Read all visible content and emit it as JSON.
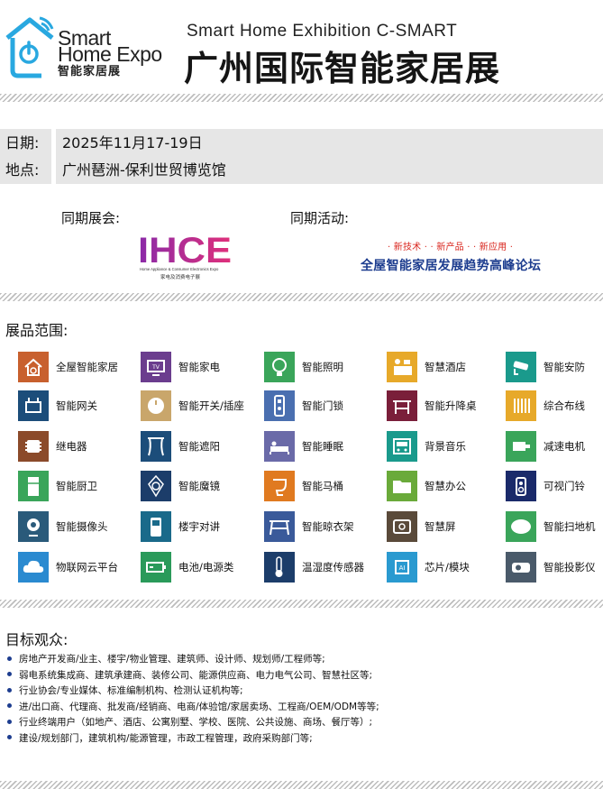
{
  "header": {
    "logo_line1": "Smart",
    "logo_line2": "Home Expo",
    "logo_line3": "智能家居展",
    "title_en": "Smart Home Exhibition C-SMART",
    "title_cn": "广州国际智能家居展"
  },
  "info": {
    "date_label": "日期:",
    "date_value": "2025年11月17-19日",
    "venue_label": "地点:",
    "venue_value": "广州琶洲-保利世贸博览馆"
  },
  "concurrent": {
    "exhibition_label": "同期展会:",
    "ihce_logo_text": "IHCE",
    "ihce_sub_en": "Home Appliance & Consumer Electronics Expo",
    "ihce_sub_cn": "家电及消费电子展",
    "activity_label": "同期活动:",
    "activity_tags": "· 新技术 ·  · 新产品 ·  · 新应用 ·",
    "activity_title": "全屋智能家居发展趋势高峰论坛"
  },
  "products": {
    "title": "展品范围:",
    "items": [
      {
        "label": "全屋智能家居",
        "icon": "smart-home-icon",
        "color": "#c8602e"
      },
      {
        "label": "智能家电",
        "icon": "tv-icon",
        "color": "#6b3d8e"
      },
      {
        "label": "智能照明",
        "icon": "bulb-icon",
        "color": "#3aa55a"
      },
      {
        "label": "智慧酒店",
        "icon": "hotel-reception-icon",
        "color": "#e7a92a"
      },
      {
        "label": "智能安防",
        "icon": "security-camera-icon",
        "color": "#1a9a8c"
      },
      {
        "label": "智能网关",
        "icon": "gateway-icon",
        "color": "#1c4d7a"
      },
      {
        "label": "智能开关/插座",
        "icon": "switch-icon",
        "color": "#c9a66b"
      },
      {
        "label": "智能门锁",
        "icon": "door-lock-icon",
        "color": "#4a6fb0"
      },
      {
        "label": "智能升降桌",
        "icon": "desk-icon",
        "color": "#7a1f3a"
      },
      {
        "label": "综合布线",
        "icon": "cabling-icon",
        "color": "#e7a92a"
      },
      {
        "label": "继电器",
        "icon": "relay-icon",
        "color": "#8b4a2a"
      },
      {
        "label": "智能遮阳",
        "icon": "curtain-icon",
        "color": "#1c4d7a"
      },
      {
        "label": "智能睡眠",
        "icon": "bed-icon",
        "color": "#6a6aa8"
      },
      {
        "label": "背景音乐",
        "icon": "music-panel-icon",
        "color": "#1a9a8c"
      },
      {
        "label": "减速电机",
        "icon": "motor-icon",
        "color": "#3aa55a"
      },
      {
        "label": "智能厨卫",
        "icon": "fridge-icon",
        "color": "#3aa55a"
      },
      {
        "label": "智能魔镜",
        "icon": "magic-mirror-icon",
        "color": "#1c3d6a"
      },
      {
        "label": "智能马桶",
        "icon": "toilet-icon",
        "color": "#e07a20"
      },
      {
        "label": "智慧办公",
        "icon": "folder-icon",
        "color": "#6aaa3a"
      },
      {
        "label": "可视门铃",
        "icon": "doorbell-icon",
        "color": "#1a2a6a"
      },
      {
        "label": "智能摄像头",
        "icon": "webcam-icon",
        "color": "#2a5a7a"
      },
      {
        "label": "楼宇对讲",
        "icon": "intercom-icon",
        "color": "#1a6a8a"
      },
      {
        "label": "智能晾衣架",
        "icon": "drying-rack-icon",
        "color": "#3a5a9a"
      },
      {
        "label": "智慧屏",
        "icon": "smart-screen-icon",
        "color": "#5a4a3a"
      },
      {
        "label": "智能扫地机",
        "icon": "robot-vacuum-icon",
        "color": "#3aa55a"
      },
      {
        "label": "物联网云平台",
        "icon": "cloud-icon",
        "color": "#2a8ad0"
      },
      {
        "label": "电池/电源类",
        "icon": "battery-icon",
        "color": "#2a9a5a"
      },
      {
        "label": "温湿度传感器",
        "icon": "thermometer-icon",
        "color": "#1c3d6a"
      },
      {
        "label": "芯片/模块",
        "icon": "ai-chip-icon",
        "color": "#2a9ad0"
      },
      {
        "label": "智能投影仪",
        "icon": "projector-icon",
        "color": "#4a5a6a"
      }
    ]
  },
  "audience": {
    "title": "目标观众:",
    "items": [
      "房地产开发商/业主、楼宇/物业管理、建筑师、设计师、规划师/工程师等;",
      "弱电系统集成商、建筑承建商、装修公司、能源供应商、电力电气公司、智慧社区等;",
      "行业协会/专业媒体、标准编制机构、检测认证机构等;",
      "进/出口商、代理商、批发商/经销商、电商/体验馆/家居卖场、工程商/OEM/ODM等等;",
      "行业终端用户（如地产、酒店、公寓别墅、学校、医院、公共设施、商场、餐厅等）;",
      "建设/规划部门，建筑机构/能源管理，市政工程管理，政府采购部门等;"
    ]
  }
}
